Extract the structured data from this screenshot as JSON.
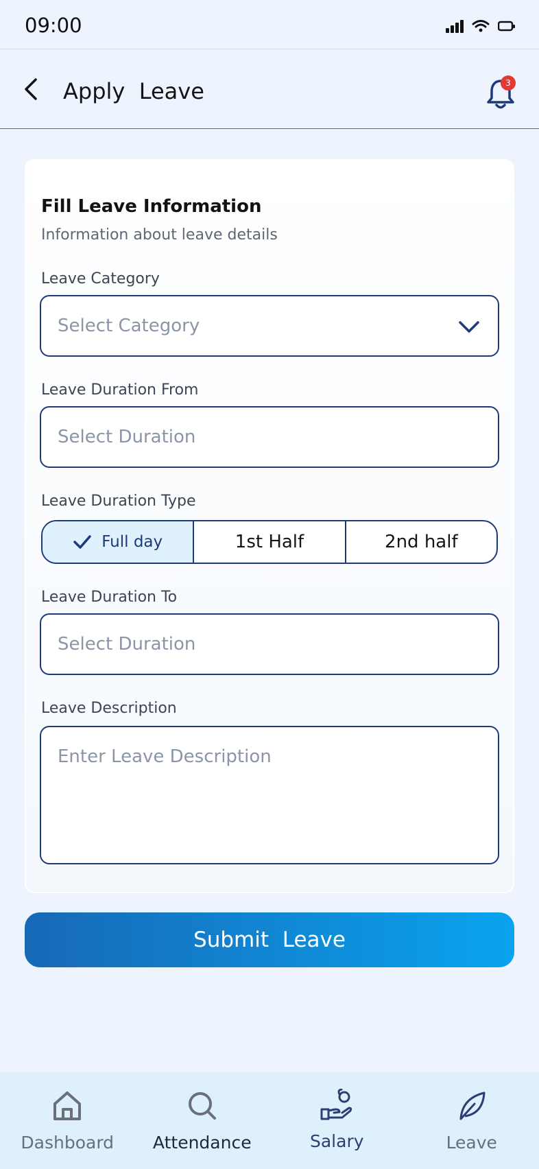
{
  "status_bar": {
    "time": "09:00"
  },
  "header": {
    "title": "Apply  Leave",
    "notification_count": "3"
  },
  "form": {
    "title": "Fill Leave Information",
    "subtitle": "Information about leave details",
    "category": {
      "label": "Leave Category",
      "placeholder": "Select Category"
    },
    "duration_from": {
      "label": "Leave Duration From",
      "placeholder": "Select Duration"
    },
    "duration_type": {
      "label": "Leave Duration Type",
      "options": [
        "Full day",
        "1st Half",
        "2nd half"
      ],
      "selected": "Full day"
    },
    "duration_to": {
      "label": "Leave Duration To",
      "placeholder": "Select Duration"
    },
    "description": {
      "label": "Leave Description",
      "placeholder": "Enter Leave Description"
    }
  },
  "submit_label": "Submit  Leave",
  "bottom_nav": {
    "items": [
      {
        "label": "Dashboard",
        "icon": "home-icon"
      },
      {
        "label": "Attendance",
        "icon": "search-icon"
      },
      {
        "label": "Salary",
        "icon": "salary-hand-icon"
      },
      {
        "label": "Leave",
        "icon": "leaf-icon"
      }
    ],
    "active": "Salary"
  },
  "colors": {
    "accent": "#1d3a7a",
    "background": "#edf4fd",
    "button_gradient_start": "#1769b7",
    "button_gradient_end": "#0aa3ee",
    "badge": "#e53935",
    "selected_segment": "#dff1fd"
  }
}
